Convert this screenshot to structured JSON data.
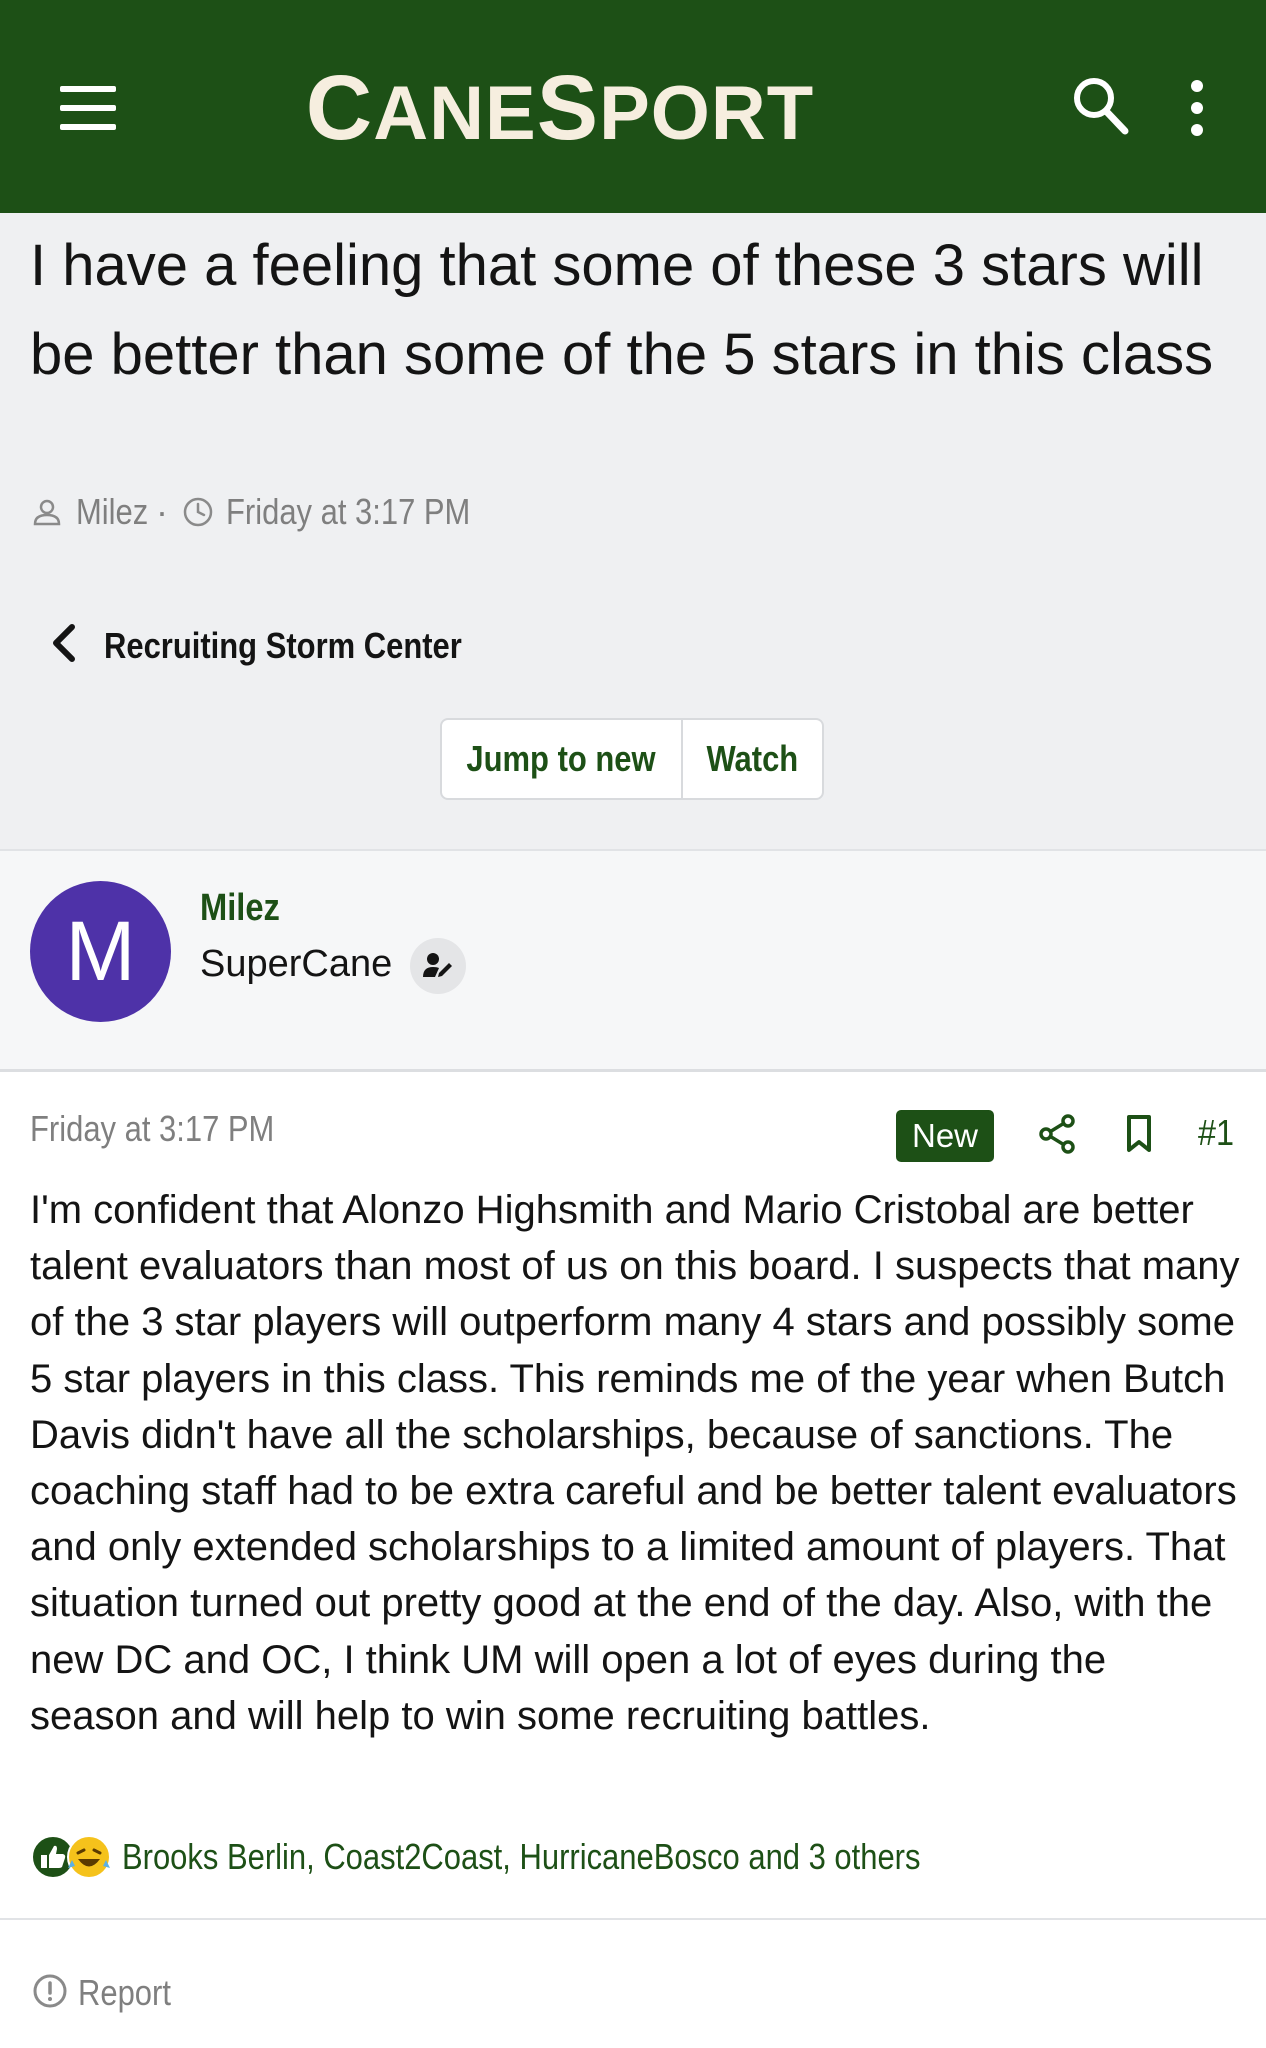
{
  "header": {
    "logo_big1": "C",
    "logo_part1": "ANE",
    "logo_big2": "S",
    "logo_part2": "PORT",
    "menu_icon": "hamburger-menu-icon",
    "search_icon": "search-icon",
    "more_icon": "more-vertical-icon",
    "background_color": "#1d5016",
    "logo_color": "#f6eedf"
  },
  "thread": {
    "title": "I have a feeling that some of these 3 stars will be better than some of the 5 stars in this class",
    "author": "Milez",
    "separator": "·",
    "date": "Friday at 3:17 PM",
    "forum": "Recruiting Storm Center",
    "jump_to_new": "Jump to new",
    "watch": "Watch"
  },
  "user": {
    "avatar_letter": "M",
    "avatar_color": "#4e32a8",
    "name": "Milez",
    "title": "SuperCane",
    "badge_icon": "user-edit-icon"
  },
  "post": {
    "date": "Friday at 3:17 PM",
    "new_badge": "New",
    "number": "#1",
    "body": "I'm confident that Alonzo Highsmith and Mario Cristobal are better talent evaluators than most of us on this board. I suspects that many of the 3 star players will outperform many 4 stars and possibly some 5 star players in this class. This reminds me of the year when Butch Davis didn't have all the scholarships, because of sanctions. The coaching staff had to be extra careful and be better talent evaluators and only extended scholarships to a limited amount of players. That situation turned out pretty good at the end of the day. Also, with the new DC and OC, I think UM will open a lot of eyes during the season and will help to win some recruiting battles.",
    "reactions_text": "Brooks Berlin, Coast2Coast, HurricaneBosco and 3 others",
    "report": "Report"
  },
  "colors": {
    "accent": "#1d5016",
    "muted_text": "#7f7f7f",
    "page_bg": "#eff0f2"
  }
}
